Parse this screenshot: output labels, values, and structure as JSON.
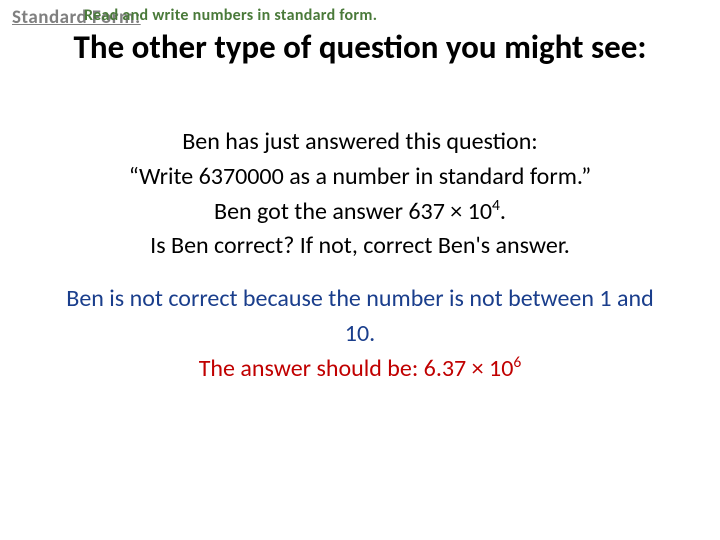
{
  "topLabel": "Standard Form:",
  "overlayText": "Read and write numbers in standard form.",
  "heading": "The other type of question you might see:",
  "question": {
    "line1": "Ben has just answered this question:",
    "line2": "“Write 6370000 as a number in standard form.”",
    "line3_a": "Ben got the answer ",
    "line3_b": "637 × 10",
    "line3_sup": "4",
    "line3_c": ".",
    "line4": "Is Ben correct? If not, correct Ben's answer."
  },
  "answer": {
    "line1": "Ben is not correct because the number is not between 1 and 10.",
    "line2_a": "The answer should be: ",
    "line2_b": "6.37 × 10",
    "line2_sup": "6"
  }
}
